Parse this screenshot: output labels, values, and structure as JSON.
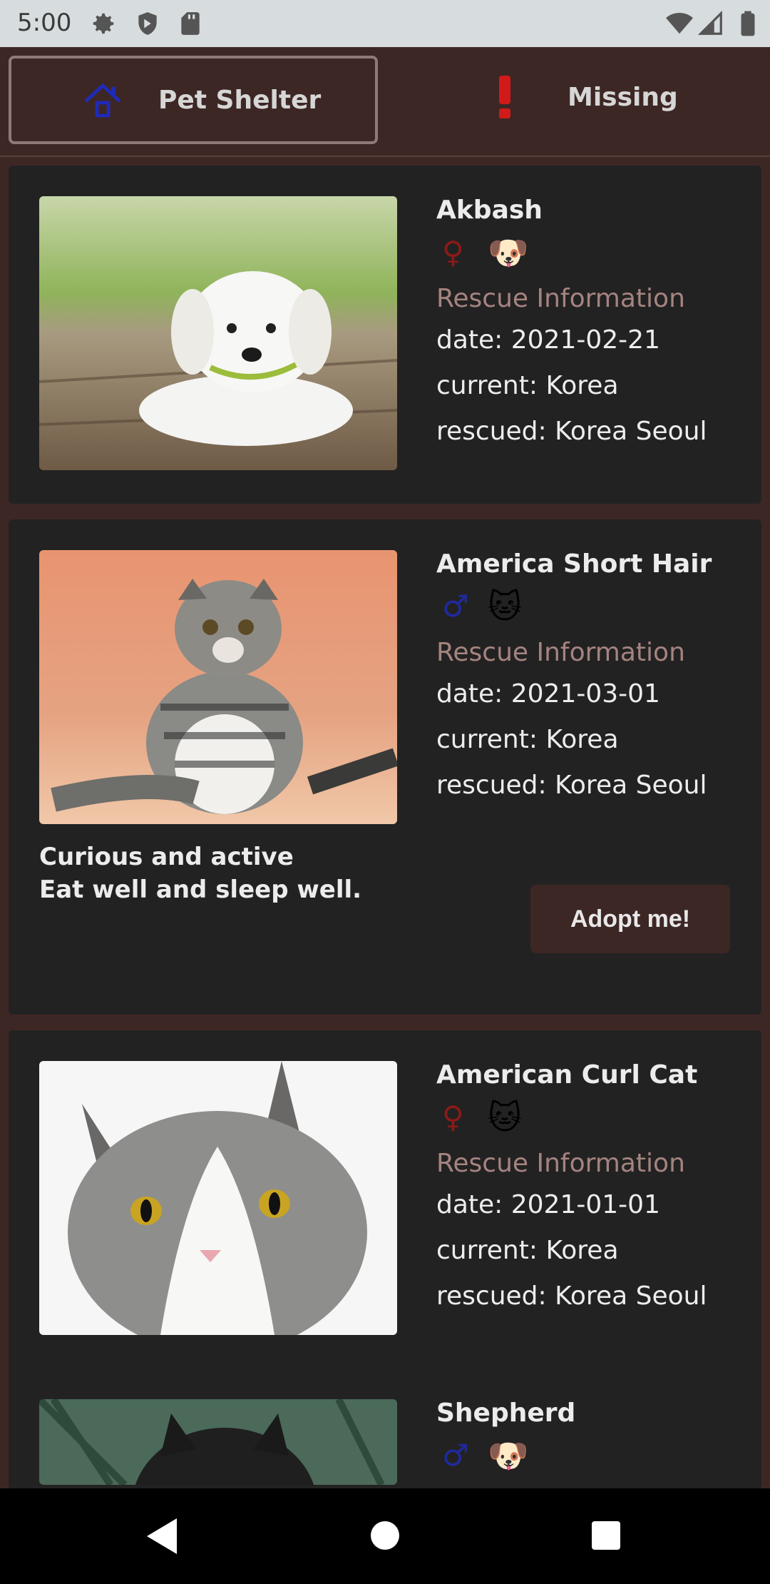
{
  "status": {
    "time": "5:00"
  },
  "tabs": [
    {
      "label": "Pet Shelter",
      "icon": "house-icon",
      "active": true
    },
    {
      "label": "Missing",
      "icon": "exclamation-icon",
      "active": false
    }
  ],
  "cards": [
    {
      "name": "Akbash",
      "sex": "♀",
      "sex_name": "female",
      "emoji": "🐶",
      "rescue_title": "Rescue Information",
      "date": "date: 2021-02-21",
      "current": "current: Korea",
      "rescued": "rescued: Korea Seoul",
      "photo": "white-puppy"
    },
    {
      "name": "America Short Hair",
      "sex": "♂",
      "sex_name": "male",
      "emoji": "🐱",
      "rescue_title": "Rescue Information",
      "date": "date: 2021-03-01",
      "current": "current: Korea",
      "rescued": "rescued: Korea Seoul",
      "description_line1": "Curious and active",
      "description_line2": "Eat well and sleep well.",
      "adopt_label": "Adopt me!",
      "photo": "tabby-cat"
    },
    {
      "name": "American Curl Cat",
      "sex": "♀",
      "sex_name": "female",
      "emoji": "🐱",
      "rescue_title": "Rescue Information",
      "date": "date: 2021-01-01",
      "current": "current: Korea",
      "rescued": "rescued: Korea Seoul",
      "photo": "grey-white-cat"
    },
    {
      "name": "Shepherd",
      "sex": "♂",
      "sex_name": "male",
      "emoji": "🐶",
      "photo": "dark-dog"
    }
  ],
  "colors": {
    "background": "#3d2725",
    "card": "#232222",
    "rescue_title": "#a48480",
    "female": "#8b1a1a",
    "male": "#1f2a9e"
  }
}
